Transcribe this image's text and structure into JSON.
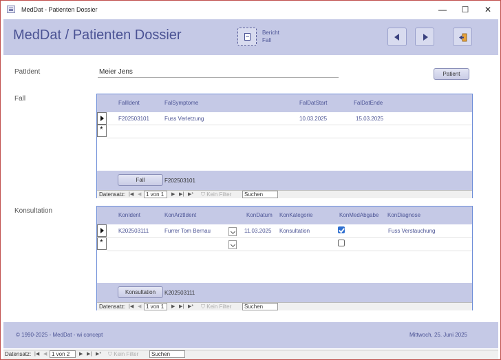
{
  "window": {
    "title": "MedDat - Patienten Dossier",
    "controls": [
      "—",
      "☐",
      "✕"
    ]
  },
  "header": {
    "title": "MedDat / Patienten Dossier",
    "report_label_line1": "Bericht",
    "report_label_line2": "Fall"
  },
  "patient": {
    "label": "PatIdent",
    "value": "Meier Jens",
    "button": "Patient"
  },
  "fall": {
    "label": "Fall",
    "columns": [
      "FallIdent",
      "FalSymptome",
      "FalDatStart",
      "FalDatEnde"
    ],
    "rows": [
      {
        "ident": "F202503101",
        "symptome": "Fuss Verletzung",
        "start": "10.03.2025",
        "ende": "15.03.2025"
      }
    ],
    "footer_button": "Fall",
    "footer_value": "F202503101",
    "nav": {
      "label": "Datensatz:",
      "position": "1 von 1",
      "filter": "Kein Filter",
      "search": "Suchen"
    }
  },
  "konsultation": {
    "label": "Konsultation",
    "columns": [
      "KonIdent",
      "KonArztIdent",
      "KonDatum",
      "KonKategorie",
      "KonMedAbgabe",
      "KonDiagnose"
    ],
    "rows": [
      {
        "ident": "K202503111",
        "arzt": "Furrer Tom Bernau",
        "datum": "11.03.2025",
        "kategorie": "Konsultation",
        "medabgabe": true,
        "diagnose": "Fuss Verstauchung"
      }
    ],
    "footer_button": "Konsultation",
    "footer_value": "K202503111",
    "nav": {
      "label": "Datensatz:",
      "position": "1 von 1",
      "filter": "Kein Filter",
      "search": "Suchen"
    }
  },
  "footer": {
    "copyright": "© 1990-2025 - MedDat - wi concept",
    "date": "Mittwoch, 25. Juni 2025"
  },
  "main_nav": {
    "label": "Datensatz:",
    "position": "1 von 2",
    "filter": "Kein Filter",
    "search": "Suchen"
  }
}
